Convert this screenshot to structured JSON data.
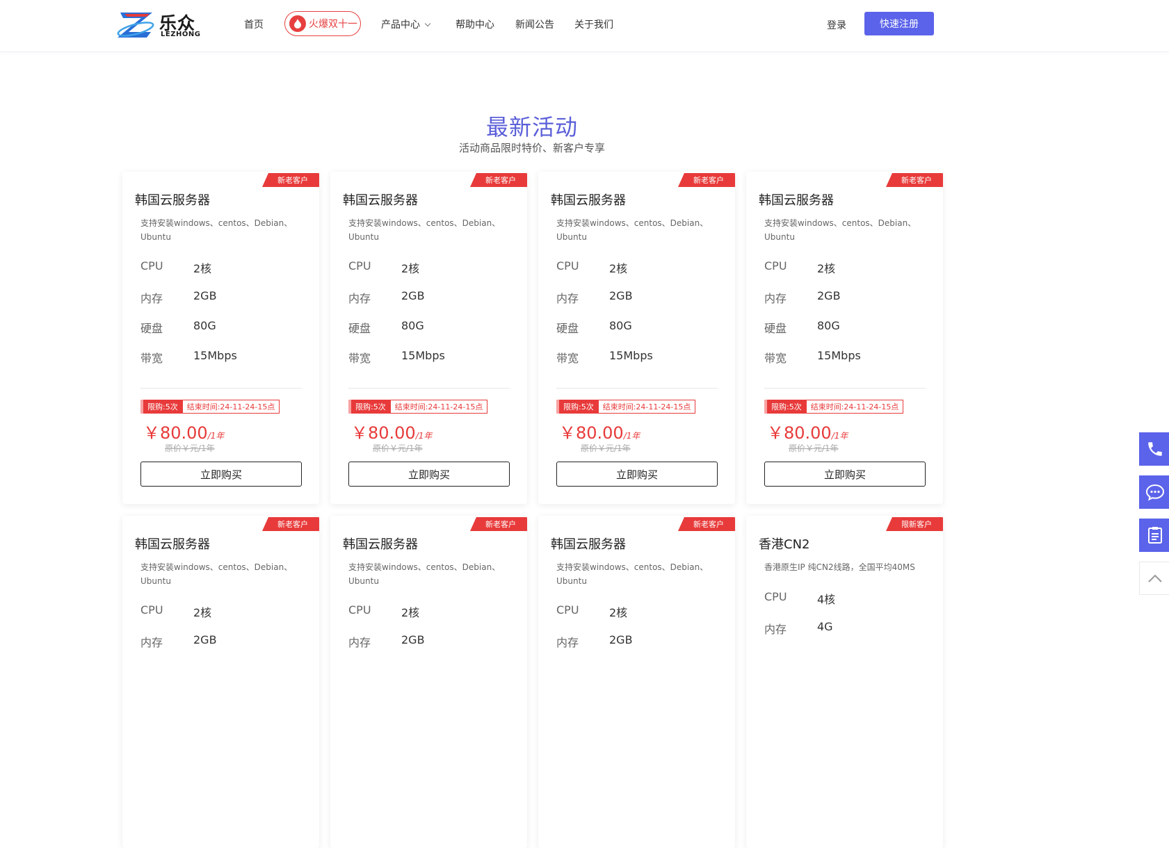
{
  "header": {
    "logo_cn": "乐众",
    "logo_en": "LEZHONG",
    "nav": {
      "home": "首页",
      "hot": "火爆双十一",
      "products": "产品中心",
      "help": "帮助中心",
      "news": "新闻公告",
      "about": "关于我们"
    },
    "login": "登录",
    "register": "快速注册"
  },
  "section": {
    "title": "最新活动",
    "subtitle": "活动商品限时特价、新客户专享"
  },
  "labels": {
    "cpu": "CPU",
    "memory": "内存",
    "disk": "硬盘",
    "bandwidth": "带宽"
  },
  "cards": [
    {
      "tag": "新老客户",
      "title": "韩国云服务器",
      "desc": "支持安装windows、centos、Debian、Ubuntu",
      "cpu": "2核",
      "memory": "2GB",
      "disk": "80G",
      "bandwidth": "15Mbps",
      "limit": "限购:5次",
      "end": "结束时间:24-11-24-15点",
      "price": "￥80.00",
      "unit": "/1年",
      "orig": "原价￥元/1年",
      "buy": "立即购买"
    },
    {
      "tag": "新老客户",
      "title": "韩国云服务器",
      "desc": "支持安装windows、centos、Debian、Ubuntu",
      "cpu": "2核",
      "memory": "2GB",
      "disk": "80G",
      "bandwidth": "15Mbps",
      "limit": "限购:5次",
      "end": "结束时间:24-11-24-15点",
      "price": "￥80.00",
      "unit": "/1年",
      "orig": "原价￥元/1年",
      "buy": "立即购买"
    },
    {
      "tag": "新老客户",
      "title": "韩国云服务器",
      "desc": "支持安装windows、centos、Debian、Ubuntu",
      "cpu": "2核",
      "memory": "2GB",
      "disk": "80G",
      "bandwidth": "15Mbps",
      "limit": "限购:5次",
      "end": "结束时间:24-11-24-15点",
      "price": "￥80.00",
      "unit": "/1年",
      "orig": "原价￥元/1年",
      "buy": "立即购买"
    },
    {
      "tag": "新老客户",
      "title": "韩国云服务器",
      "desc": "支持安装windows、centos、Debian、Ubuntu",
      "cpu": "2核",
      "memory": "2GB",
      "disk": "80G",
      "bandwidth": "15Mbps",
      "limit": "限购:5次",
      "end": "结束时间:24-11-24-15点",
      "price": "￥80.00",
      "unit": "/1年",
      "orig": "原价￥元/1年",
      "buy": "立即购买"
    },
    {
      "tag": "新老客户",
      "title": "韩国云服务器",
      "desc": "支持安装windows、centos、Debian、Ubuntu",
      "cpu": "2核",
      "memory": "2GB"
    },
    {
      "tag": "新老客户",
      "title": "韩国云服务器",
      "desc": "支持安装windows、centos、Debian、Ubuntu",
      "cpu": "2核",
      "memory": "2GB"
    },
    {
      "tag": "新老客户",
      "title": "韩国云服务器",
      "desc": "支持安装windows、centos、Debian、Ubuntu",
      "cpu": "2核",
      "memory": "2GB"
    },
    {
      "tag": "限新客户",
      "title": "香港CN2",
      "desc": "香港原生IP 纯CN2线路，全国平均40MS",
      "cpu": "4核",
      "memory": "4G"
    }
  ],
  "sidebar": [
    "phone-icon",
    "chat-icon",
    "document-icon",
    "back-to-top-icon"
  ],
  "colors": {
    "accent": "#5b63ea",
    "title": "#5b5fd8",
    "red": "#e83a3a"
  }
}
